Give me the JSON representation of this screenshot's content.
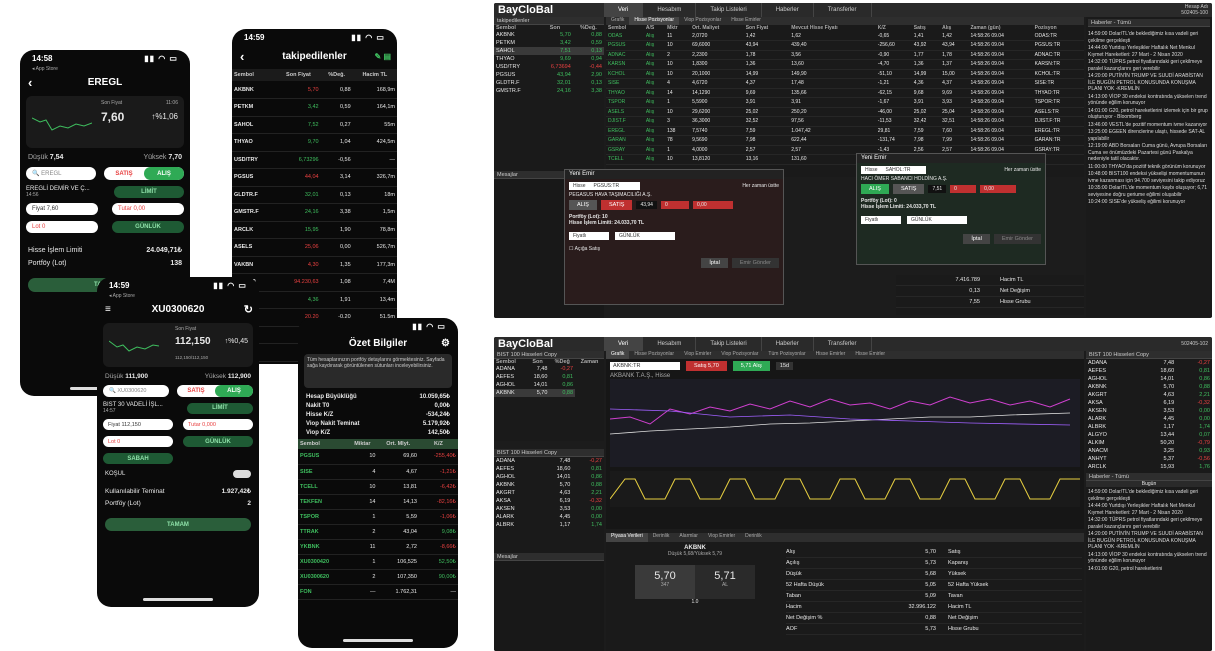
{
  "phone1": {
    "time": "14:58",
    "back_app": "◂ App Store",
    "title": "EREGL",
    "last_label": "Son Fiyat",
    "last_time": "11:06",
    "last_price": "7,60",
    "change": "↑%1,06",
    "low_label": "Düşük",
    "low": "7,54",
    "high_label": "Yüksek",
    "high": "7,70",
    "search_placeholder": "EREGL",
    "sell": "SATIŞ",
    "buy": "ALIŞ",
    "symbol_name": "EREGLİ DEMİR VE Ç...",
    "symbol_time": "14:56",
    "limit": "LİMİT",
    "price_label": "Fiyat 7,60",
    "amount_label": "Tutar 0,00",
    "lot_label": "Lot 0",
    "validity": "GÜNLÜK",
    "limit_label": "Hisse İşlem Limiti",
    "limit_value": "24.049,71₺",
    "portfolio_label": "Portföy (Lot)",
    "portfolio_value": "138",
    "ok": "TAMAM"
  },
  "phone2": {
    "time": "14:59",
    "back_app": "◂ App Store",
    "title": "XU0300620",
    "last_label": "Son Fiyat",
    "last_price": "112,150",
    "change": "↑%0,45",
    "range": "112,150/112,150",
    "low_label": "Düşük",
    "low": "111,900",
    "high_label": "Yüksek",
    "high": "112,900",
    "search_placeholder": "XU0300620",
    "sell": "SATIŞ",
    "buy": "ALIŞ",
    "symbol_name": "BIST 30 VADELİ İŞL...",
    "symbol_time": "14:57",
    "limit": "LİMİT",
    "price_label": "Fiyat 112,150",
    "amount_label": "Tutar 0,000",
    "lot_label": "Lot 0",
    "validity": "GÜNLÜK",
    "session": "SABAH",
    "cond": "KOŞUL",
    "teminat_label": "Kullanılabilir Teminat",
    "teminat": "1.927,42₺",
    "portfolio_label": "Portföy (Lot)",
    "portfolio_value": "2",
    "ok": "TAMAM"
  },
  "phone3": {
    "time": "14:59",
    "title": "takipedilenler",
    "headers": [
      "Sembol",
      "Son Fiyat",
      "%Değ.",
      "Hacim TL"
    ],
    "rows": [
      [
        "AKBNK",
        "5,70",
        "0,88",
        "168,9m",
        "r"
      ],
      [
        "PETKM",
        "3,42",
        "0,59",
        "164,1m",
        "g"
      ],
      [
        "SAHOL",
        "7,52",
        "0,27",
        "55m",
        "g"
      ],
      [
        "THYAO",
        "9,70",
        "1,04",
        "424,5m",
        "g"
      ],
      [
        "USD/TRY",
        "6,73296",
        "-0,56",
        "—",
        "g"
      ],
      [
        "PGSUS",
        "44,04",
        "3,14",
        "326,7m",
        "r"
      ],
      [
        "GLDTR.F",
        "32,01",
        "0,13",
        "18m",
        "g"
      ],
      [
        "GMSTR.F",
        "24,16",
        "3,38",
        "1,5m",
        "g"
      ],
      [
        "ARCLK",
        "15,95",
        "1,90",
        "78,8m",
        "g"
      ],
      [
        "ASELS",
        "25,06",
        "0,00",
        "526,7m",
        "r"
      ],
      [
        "VAKBN",
        "4,30",
        "1,35",
        "177,3m",
        "r"
      ],
      [
        "BIST100",
        "94.230,63",
        "1,08",
        "7,4M",
        "r"
      ],
      [
        "DOHOL",
        "4,36",
        "1,91",
        "13,4m",
        "g"
      ],
      [
        "SASA",
        "20,20",
        "-0,20",
        "51,5m",
        "r"
      ],
      [
        "TCELL",
        "13,02",
        "-0,29",
        "70,9m",
        "r"
      ],
      [
        "TUPRS",
        "65,70",
        "3,98",
        "332m",
        "r"
      ],
      [
        "TTKOM",
        "0,09",
        "-0,55",
        "177,9m",
        "r"
      ]
    ]
  },
  "phone4": {
    "title": "Özet Bilgiler",
    "info": "Tüm hesaplarınızın portföy detaylarını görmektesiniz. Sayfada sağa kaydırarak görüntülenen sütunları inceleyebilirsiniz.",
    "rows": [
      [
        "Hesap Büyüklüğü",
        "10.059,65₺"
      ],
      [
        "Nakit T0",
        "0,00₺"
      ],
      [
        "Hisse K/Z",
        "-534,24₺"
      ],
      [
        "Viop Nakit Teminat",
        "5.179,92₺"
      ],
      [
        "Viop K/Z",
        "142,50₺"
      ]
    ],
    "headers": [
      "Sembol",
      "Miktar",
      "Ort. Mlyt.",
      "K/Z"
    ],
    "pos": [
      [
        "PGSUS",
        "10",
        "69,60",
        "-255,40₺",
        "r"
      ],
      [
        "SISE",
        "4",
        "4,67",
        "-1,21₺",
        "r"
      ],
      [
        "TCELL",
        "10",
        "13,81",
        "-6,42₺",
        "r"
      ],
      [
        "TEKFEN",
        "14",
        "14,13",
        "-82,16₺",
        "r"
      ],
      [
        "TSPOR",
        "1",
        "5,59",
        "-1,06₺",
        "r"
      ],
      [
        "TTRAK",
        "2",
        "43,04",
        "9,08₺",
        "g"
      ],
      [
        "YKBNK",
        "11",
        "2,72",
        "-8,66₺",
        "r"
      ],
      [
        "XU0300420",
        "1",
        "106,525",
        "52,50₺",
        "g"
      ],
      [
        "XU0300620",
        "2",
        "107,350",
        "90,00₺",
        "g"
      ],
      [
        "FON",
        "—",
        "1.762,31",
        "—",
        "w"
      ]
    ]
  },
  "desk1": {
    "logo": "BayCloBal",
    "tabs": [
      "Veri",
      "Hesabım",
      "Takip Listeleri",
      "Haberler",
      "Transferler"
    ],
    "account": "Hesap Adı",
    "account_no": "502405-100",
    "left_title": "takipedilenler",
    "subtabs": [
      "Grafik",
      "Hisse Pozisyonlar",
      "Viop Pozisyonlar",
      "Hisse Emirler"
    ],
    "left_headers": [
      "Sembol",
      "Son",
      "%Değ."
    ],
    "left_rows": [
      [
        "AKBNK",
        "5,70",
        "0,88"
      ],
      [
        "PETKM",
        "3,42",
        "0,59"
      ],
      [
        "SAHOL",
        "7,51",
        "0,13"
      ],
      [
        "THYAO",
        "9,69",
        "0,94"
      ],
      [
        "USD/TRY",
        "6,73694",
        "-0,44"
      ],
      [
        "PGSUS",
        "43,94",
        "2,90"
      ],
      [
        "GLDTR.F",
        "32,01",
        "0,13"
      ],
      [
        "GMSTR.F",
        "24,16",
        "3,38"
      ]
    ],
    "pos_headers": [
      "Sembol",
      "A/S",
      "Mktr",
      "Ort. Maliyet",
      "Son Fiyat",
      "Mevcut Hisse Fiyatı",
      "K/Z",
      "Satış",
      "Alış",
      "Zaman (gün)",
      "Pozisyon"
    ],
    "pos_rows": [
      [
        "ODAS",
        "Alış",
        "11",
        "2,0720",
        "1,42",
        "1,62",
        "-0,65",
        "1,41",
        "1,42",
        "14:58:26 09.04",
        "ODAS:TR"
      ],
      [
        "PGSUS",
        "Alış",
        "10",
        "69,6000",
        "43,94",
        "439,40",
        "-256,60",
        "43,92",
        "43,94",
        "14:58:26 09.04",
        "PGSUS:TR"
      ],
      [
        "ADNAC",
        "Alış",
        "2",
        "2,2300",
        "1,78",
        "3,56",
        "-0,90",
        "1,77",
        "1,78",
        "14:58:26 09.04",
        "ADNAC:TR"
      ],
      [
        "KARSN",
        "Alış",
        "10",
        "1,8300",
        "1,36",
        "13,60",
        "-4,70",
        "1,36",
        "1,37",
        "14:58:26 09.04",
        "KARSN:TR"
      ],
      [
        "KCHOL",
        "Alış",
        "10",
        "20,1000",
        "14,99",
        "149,90",
        "-51,10",
        "14,99",
        "15,00",
        "14:58:26 09.04",
        "KCHOL:TR"
      ],
      [
        "SISE",
        "Alış",
        "4",
        "4,6720",
        "4,37",
        "17,48",
        "-1,21",
        "4,36",
        "4,37",
        "14:58:26 09.04",
        "SISE:TR"
      ],
      [
        "THYAO",
        "Alış",
        "14",
        "14,1290",
        "9,69",
        "135,66",
        "-62,15",
        "9,68",
        "9,69",
        "14:58:26 09.04",
        "THYAO:TR"
      ],
      [
        "TSPOR",
        "Alış",
        "1",
        "5,5900",
        "3,91",
        "3,91",
        "-1,67",
        "3,91",
        "3,93",
        "14:58:26 09.04",
        "TSPOR:TR"
      ],
      [
        "ASELS",
        "Alış",
        "10",
        "29,6200",
        "25,02",
        "250,20",
        "-46,00",
        "25,02",
        "25,04",
        "14:58:26 09.04",
        "ASELS:TR"
      ],
      [
        "DJIST.F",
        "Alış",
        "3",
        "36,3000",
        "32,52",
        "97,56",
        "-11,53",
        "32,42",
        "32,51",
        "14:58:26 09.04",
        "DJIST.F:TR"
      ],
      [
        "EREGL",
        "Alış",
        "138",
        "7,5740",
        "7,59",
        "1.047,42",
        "29,81",
        "7,59",
        "7,60",
        "14:58:26 09.04",
        "EREGL:TR"
      ],
      [
        "GARAN",
        "Alış",
        "78",
        "9,5690",
        "7,98",
        "622,44",
        "-131,74",
        "7,98",
        "7,99",
        "14:58:26 09.04",
        "GARAN:TR"
      ],
      [
        "GSRAY",
        "Alış",
        "1",
        "4,0000",
        "2,57",
        "2,57",
        "-1,43",
        "2,56",
        "2,57",
        "14:58:26 09.04",
        "GSRAY:TR"
      ],
      [
        "TCELL",
        "Alış",
        "10",
        "13,8120",
        "13,16",
        "131,60",
        "—",
        "—",
        "—",
        "—",
        "—"
      ]
    ],
    "order1": {
      "title": "Yeni Emir",
      "type": "Hisse",
      "symbol": "PGSUS:TR",
      "name": "PEGASUS HAVA TAŞIMACILIĞI A.Ş.",
      "buy": "ALIŞ",
      "sell": "SATIŞ",
      "price": "43,94",
      "lot": "0",
      "amount": "0,00",
      "always_top": "Her zaman üstte",
      "portfolio": "Portföy (Lot): 10",
      "limit": "Hisse İşlem Limiti: 24.033,70 TL",
      "order_type": "Fiyatlı",
      "validity": "GÜNLÜK",
      "short": "Açığa Satış",
      "cancel": "İptal",
      "send": "Emir Gönder"
    },
    "order2": {
      "title": "Yeni Emir",
      "type": "Hisse",
      "symbol": "SAHOL:TR",
      "name": "HACI ÖMER SABANCI HOLDİNG A.Ş.",
      "buy": "ALIŞ",
      "sell": "SATIŞ",
      "price": "7,51",
      "lot": "0",
      "amount": "0,00",
      "always_top": "Her zaman üstte",
      "portfolio": "Portföy (Lot): 0",
      "limit": "Hisse İşlem Limiti: 24.033,70 TL",
      "order_type": "Fiyatlı",
      "validity": "GÜNLÜK",
      "cancel": "İptal",
      "send": "Emir Gönder"
    },
    "news_title": "Haberler - Tümü",
    "news": [
      "14:59:00 Dolar/TL'de beklediğimiz kısa vadeli geri çekilme gerçekleşti",
      "14:44:00 Yurtdışı Yerleşikler Haftalık Net Menkul Kıymet Hareketleri: 27 Mart - 2 Nisan 2020",
      "14:32:00 TÜPRS petrol fiyatlarındaki geri çekilmeye paralel kazançlarını geri verebilir",
      "14:20:00 PUTİN'İN TRUMP VE SUUDİ ARABİSTAN İLE BUGÜN PETROL KONUSUNDA KONUŞMA PLANI YOK -KREMLİN",
      "14:13:00 VİOP 30 endeksi kontratında yükselen trend yönünde eğilim korunuyor",
      "14:01:00 G20, petrol hareketlerini izlemek için bir grup oluşturuyor - Bloomberg",
      "13:46:00 VESTL'de pozitif momentum ivme kazanıyor",
      "13:25:00 EGEEN direnclerine ulaştı, hissede SAT-AL yapılabilir",
      "12:19:00 ABD Borsaları Cuma günü, Avrupa Borsaları Cuma ve önümüzdeki Pazartesi günü Paskalya nedeniyle tatil olacaktır.",
      "11:00:00 THYAO'da pozitif teknik görünüm korunuyor",
      "10:48:00 BIST100 endeksi yükselişi momentumunun ivme kazanması için 94.700 seviyesini takip ediyoruz",
      "10:35:00 Dolar/TL'de momentum kaybı oluşuyor; 6,71 seviyesine doğru geriume eğilimi oluşabilir",
      "10:24:00 SISE'de yükseliş eğilimi korunuyor"
    ],
    "stats": [
      [
        "7.416.789",
        "Hacim TL"
      ],
      [
        "0,13",
        "Net Değişim"
      ],
      [
        "7,55",
        "Hisse Grubu"
      ]
    ],
    "mesajlar": "Mesajlar"
  },
  "desk2": {
    "logo": "BayCloBal",
    "tabs": [
      "Veri",
      "Hesabım",
      "Takip Listeleri",
      "Haberler",
      "Transferler"
    ],
    "account_no": "502405-102",
    "left_title": "BIST 100 Hisseleri Copy",
    "left2_title": "BIST 100 Hisseleri Copy",
    "subtabs": [
      "Grafik",
      "Hisse Pozisyonlar",
      "Viop Emirler",
      "Viop Pozisyonlar",
      "Tüm Pozisyonlar",
      "Hisse Emirler",
      "Hisse Emirler"
    ],
    "chart_symbol": "AKBNK:TR",
    "chart_title": "AKBANK T.A.Ş., Hisse",
    "sell_btn": "Satış 5,70",
    "buy_btn": "5,71 Alış",
    "interval": "15d",
    "left_headers": [
      "Sembol",
      "Son",
      "%Değ",
      "Zaman"
    ],
    "left_rows": [
      [
        "ADANA",
        "7,48",
        "-0,27"
      ],
      [
        "AEFES",
        "18,60",
        "0,81"
      ],
      [
        "AGHOL",
        "14,01",
        "0,86"
      ],
      [
        "AKBNK",
        "5,70",
        "0,88"
      ]
    ],
    "left2_rows": [
      [
        "ADANA",
        "7,48",
        "-0,27"
      ],
      [
        "AEFES",
        "18,60",
        "0,81"
      ],
      [
        "AGHOL",
        "14,01",
        "0,86"
      ],
      [
        "AKBNK",
        "5,70",
        "0,88"
      ],
      [
        "AKGRT",
        "4,63",
        "2,21"
      ],
      [
        "AKSA",
        "6,19",
        "-0,32"
      ],
      [
        "AKSEN",
        "3,53",
        "0,00"
      ],
      [
        "ALARK",
        "4,45",
        "0,00"
      ],
      [
        "ALBRK",
        "1,17",
        "1,74"
      ]
    ],
    "right_rows": [
      [
        "ADANA",
        "7,48",
        "-0,27"
      ],
      [
        "AEFES",
        "18,60",
        "0,81"
      ],
      [
        "AGHOL",
        "14,01",
        "0,86"
      ],
      [
        "AKBNK",
        "5,70",
        "0,88"
      ],
      [
        "AKGRT",
        "4,63",
        "2,21"
      ],
      [
        "AKSA",
        "6,19",
        "-0,32"
      ],
      [
        "AKSEN",
        "3,53",
        "0,00"
      ],
      [
        "ALARK",
        "4,45",
        "0,00"
      ],
      [
        "ALBRK",
        "1,17",
        "1,74"
      ],
      [
        "ALGYO",
        "13,44",
        "0,07"
      ],
      [
        "ALKIM",
        "50,20",
        "-0,79"
      ],
      [
        "ANACM",
        "3,25",
        "0,93"
      ],
      [
        "ANHYT",
        "5,37",
        "-0,56"
      ],
      [
        "ARCLK",
        "15,93",
        "1,76"
      ]
    ],
    "market_tabs": [
      "Piyasa Verileri",
      "Derinlik",
      "Alarmlar",
      "Viop Emirler",
      "Derinlik"
    ],
    "mk_name": "AKBNK",
    "mk_sub": "Düşük 5,68/Yüksek 5,79",
    "bid": "5,70",
    "ask": "5,71",
    "bid_sz": "347",
    "ask_sz": "AL",
    "mid": "1.0",
    "stats": [
      [
        "Alış",
        "5,70",
        "Satış"
      ],
      [
        "Açılış",
        "5,73",
        "Kapanış"
      ],
      [
        "Düşük",
        "5,68",
        "Yüksek"
      ],
      [
        "52 Hafta Düşük",
        "5,05",
        "52 Hafta Yüksek"
      ],
      [
        "Taban",
        "5,09",
        "Tavan"
      ],
      [
        "Hacim",
        "32.996.122",
        "Hacim TL"
      ],
      [
        "Net Değişim %",
        "0,88",
        "Net Değişim"
      ],
      [
        "AOF",
        "5,73",
        "Hisse Grubu"
      ]
    ],
    "news_title": "Haberler - Tümü",
    "news_date": "Bugün",
    "news": [
      "14:59:00 Dolar/TL'de beklediğimiz kısa vadeli geri çekilme gerçekleşti",
      "14:44:00 Yurtdışı Yerleşikler Haftalık Net Menkul Kıymet Hareketleri: 27 Mart - 2 Nisan 2020",
      "14:32:00 TÜPRS petrol fiyatlarındaki geri çekilmeye paralel kazançlarını geri verebilir",
      "14:20:00 PUTİN'İN TRUMP VE SUUDİ ARABİSTAN İLE BUGÜN PETROL KONUSUNDA KONUŞMA PLANI YOK -KREMLİN",
      "14:13:00 VİOP 30 endeksi kontratında yükselen trend yönünde eğilim korunuyor",
      "14:01:00 G20, petrol hareketlerini"
    ],
    "mesajlar": "Mesajlar"
  }
}
